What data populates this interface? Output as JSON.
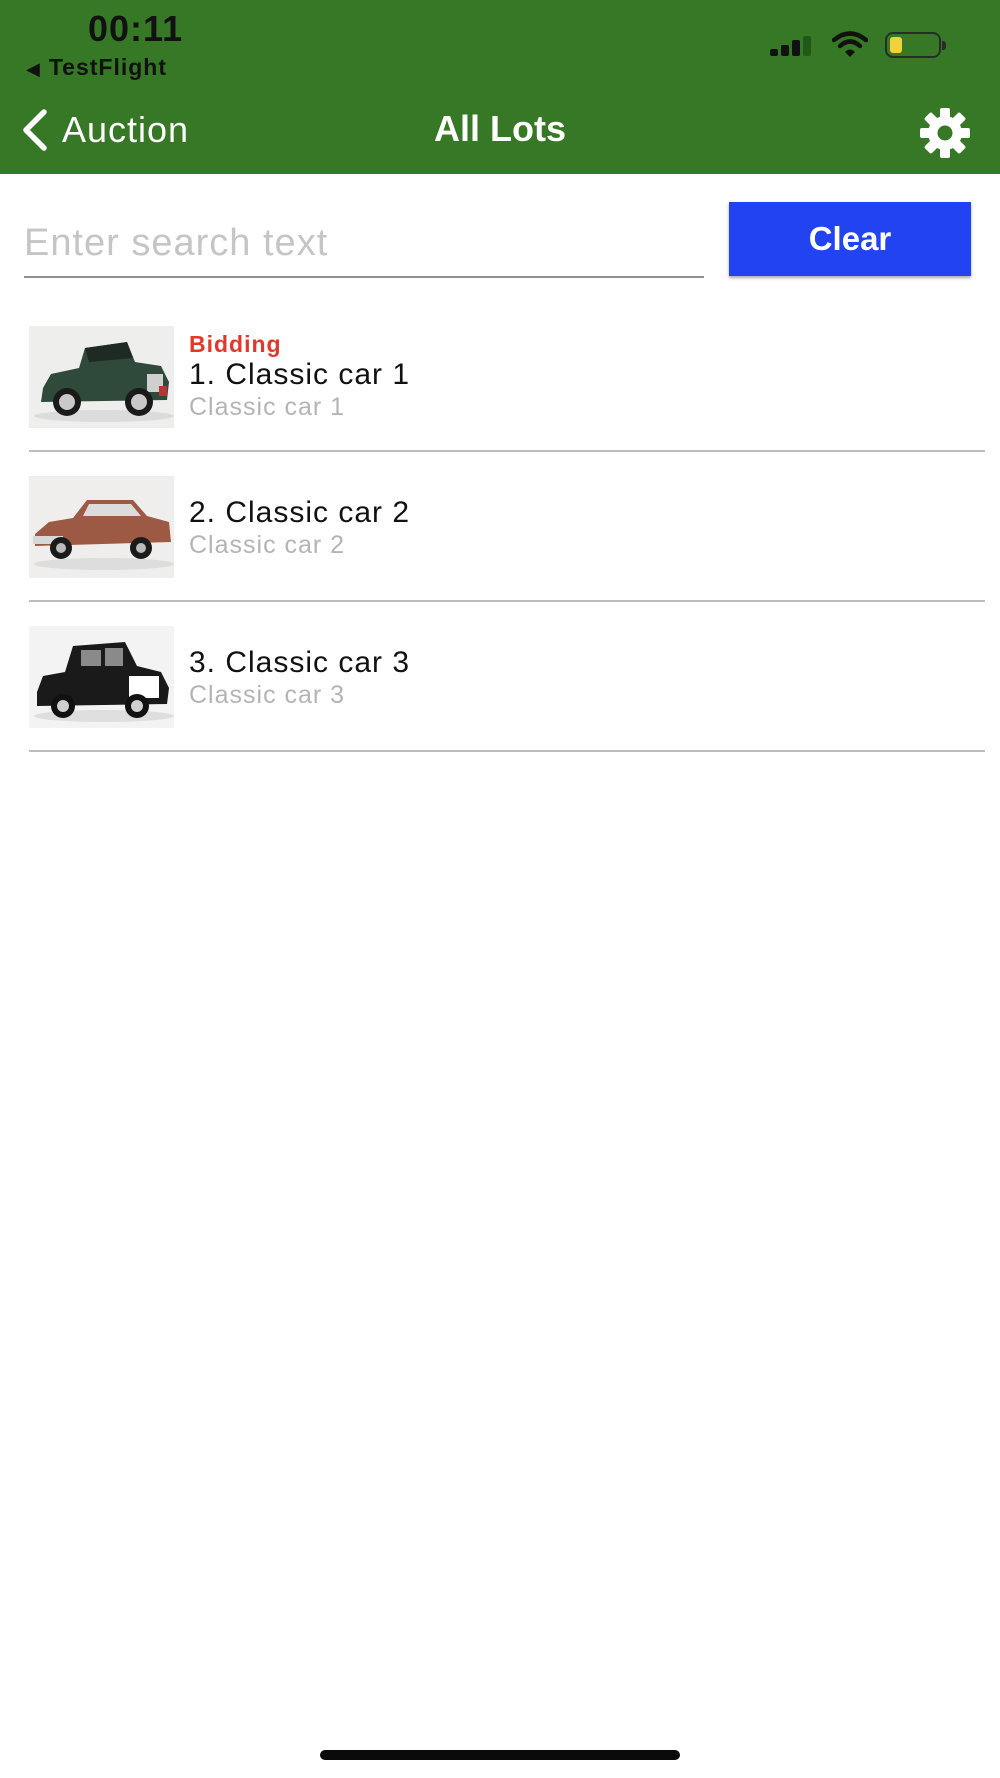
{
  "status_bar": {
    "time": "00:11",
    "back_app_label": "TestFlight",
    "back_icon": "back-triangle-icon",
    "signal_icon": "cellular-signal-icon",
    "wifi_icon": "wifi-icon",
    "battery_icon": "battery-icon",
    "battery_level": 0.2
  },
  "nav_bar": {
    "back_label": "Auction",
    "back_icon": "chevron-left-icon",
    "title": "All Lots",
    "settings_icon": "gear-icon",
    "background_color": "#377826"
  },
  "search": {
    "placeholder": "Enter search text",
    "value": "",
    "clear_label": "Clear",
    "clear_color": "#2243f1"
  },
  "lots": [
    {
      "status": "Bidding",
      "title": "1. Classic car 1",
      "subtitle": "Classic car 1",
      "thumbnail": "classic-car-green-convertible"
    },
    {
      "status": "",
      "title": "2. Classic car 2",
      "subtitle": "Classic car 2",
      "thumbnail": "classic-car-copper-sedan"
    },
    {
      "status": "",
      "title": "3. Classic car 3",
      "subtitle": "Classic car 3",
      "thumbnail": "classic-car-black-limousine"
    }
  ],
  "colors": {
    "status_bidding": "#e0382b"
  }
}
